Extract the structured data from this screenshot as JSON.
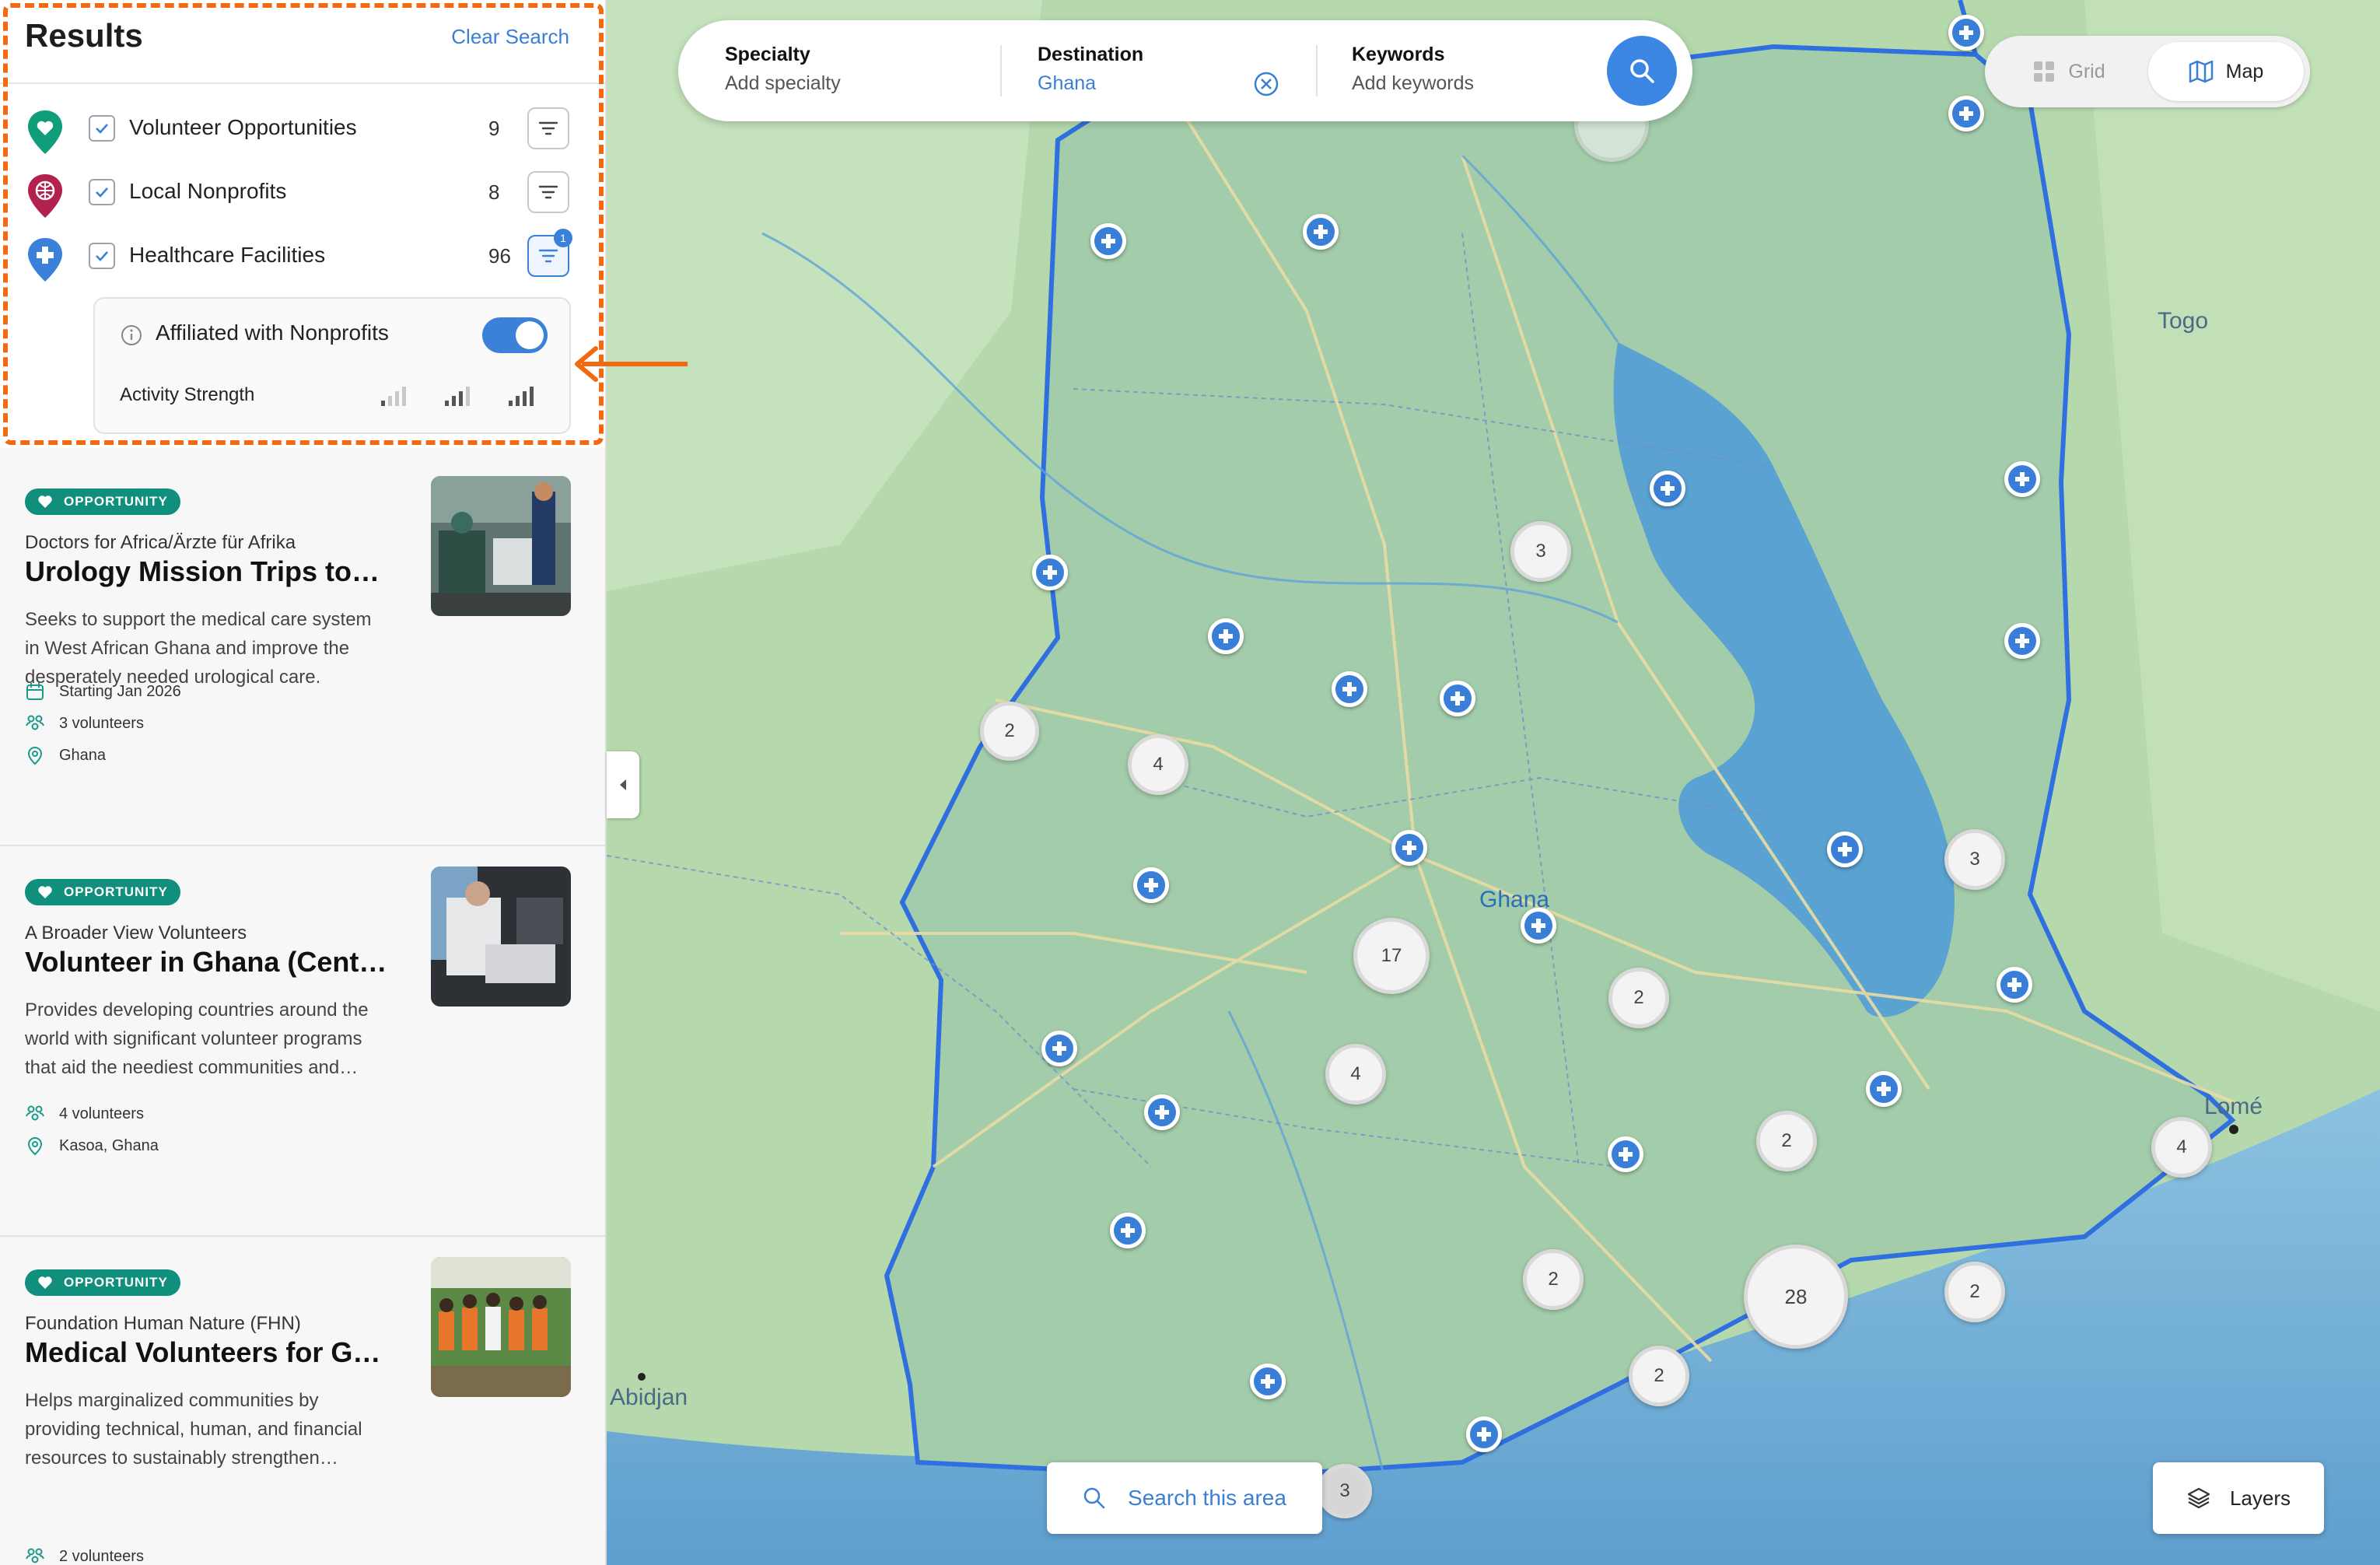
{
  "sidebar": {
    "title": "Results",
    "clear_search": "Clear Search",
    "filters": [
      {
        "label": "Volunteer Opportunities",
        "count": "9",
        "color": "#0f9d7a"
      },
      {
        "label": "Local Nonprofits",
        "count": "8",
        "color": "#b3214f"
      },
      {
        "label": "Healthcare Facilities",
        "count": "96",
        "color": "#3b80d9",
        "badge": "1"
      }
    ],
    "sub_panel": {
      "affiliated_label": "Affiliated with Nonprofits",
      "affiliated_on": true,
      "activity_label": "Activity Strength"
    }
  },
  "cards": [
    {
      "badge": "OPPORTUNITY",
      "org": "Doctors for Africa/Ärzte für Afrika",
      "title": "Urology Mission Trips to…",
      "description": "Seeks to support the medical care system in West African Ghana and improve the desperately needed urological care.",
      "starting": "Starting Jan 2026",
      "volunteers": "3 volunteers",
      "location": "Ghana"
    },
    {
      "badge": "OPPORTUNITY",
      "org": "A Broader View Volunteers",
      "title": "Volunteer in Ghana (Central…",
      "description": "Provides developing countries around the world with significant volunteer programs that aid the neediest communities and…",
      "volunteers": "4 volunteers",
      "location": "Kasoa, Ghana"
    },
    {
      "badge": "OPPORTUNITY",
      "org": "Foundation Human Nature (FHN)",
      "title": "Medical Volunteers for Ghana",
      "description": "Helps marginalized communities by providing technical, human, and financial resources to sustainably strengthen…",
      "volunteers": "2 volunteers"
    }
  ],
  "search": {
    "specialty_title": "Specialty",
    "specialty_placeholder": "Add specialty",
    "destination_title": "Destination",
    "destination_value": "Ghana",
    "keywords_title": "Keywords",
    "keywords_placeholder": "Add keywords"
  },
  "view_toggle": {
    "grid": "Grid",
    "map": "Map",
    "selected": "Map"
  },
  "map": {
    "labels": {
      "togo": "Togo",
      "ghana": "Ghana",
      "lome": "Lomé",
      "abidjan": "Abidjan"
    },
    "clusters": [
      "3",
      "2",
      "4",
      "17",
      "4",
      "2",
      "3",
      "2",
      "4",
      "28",
      "2",
      "2",
      "2",
      "3"
    ],
    "search_area": "Search this area",
    "layers": "Layers"
  }
}
